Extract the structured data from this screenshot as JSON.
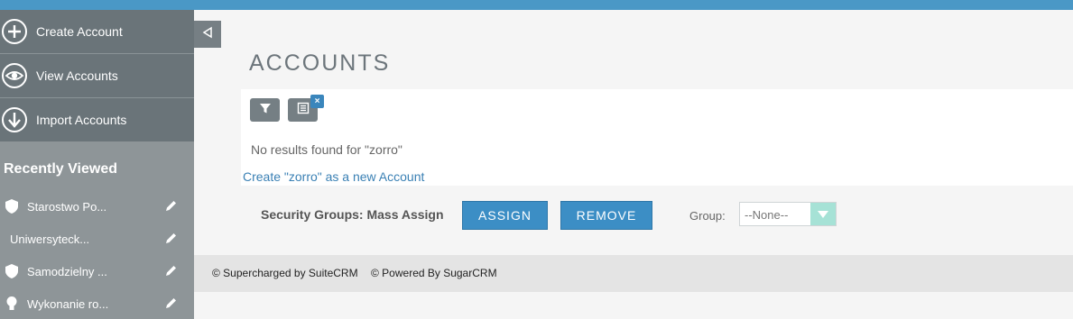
{
  "sidebar": {
    "actions": [
      {
        "label": "Create Account",
        "icon": "plus-circle-icon"
      },
      {
        "label": "View Accounts",
        "icon": "eye-icon"
      },
      {
        "label": "Import Accounts",
        "icon": "download-circle-icon"
      }
    ],
    "recent_title": "Recently Viewed",
    "recent": [
      {
        "label": "Starostwo Po...",
        "icon": "shield-icon"
      },
      {
        "label": "Uniwersyteck...",
        "icon": ""
      },
      {
        "label": "Samodzielny ...",
        "icon": "shield-icon"
      },
      {
        "label": "Wykonanie ro...",
        "icon": "lightbulb-icon"
      }
    ]
  },
  "main": {
    "title": "ACCOUNTS",
    "no_results": "No results found for \"zorro\"",
    "create_link": "Create \"zorro\" as a new Account",
    "clear_badge": "×"
  },
  "mass_assign": {
    "label": "Security Groups: Mass Assign",
    "assign": "ASSIGN",
    "remove": "REMOVE",
    "group_label": "Group:",
    "group_value": "--None--"
  },
  "footer": {
    "suitecrm": "© Supercharged by SuiteCRM",
    "sugarcrm": "© Powered By SugarCRM"
  },
  "colors": {
    "topbar": "#4a98c6",
    "sidebar": "#8e9598",
    "actions": "#6a7479",
    "button": "#3c8ec5",
    "link": "#3a80b4"
  }
}
